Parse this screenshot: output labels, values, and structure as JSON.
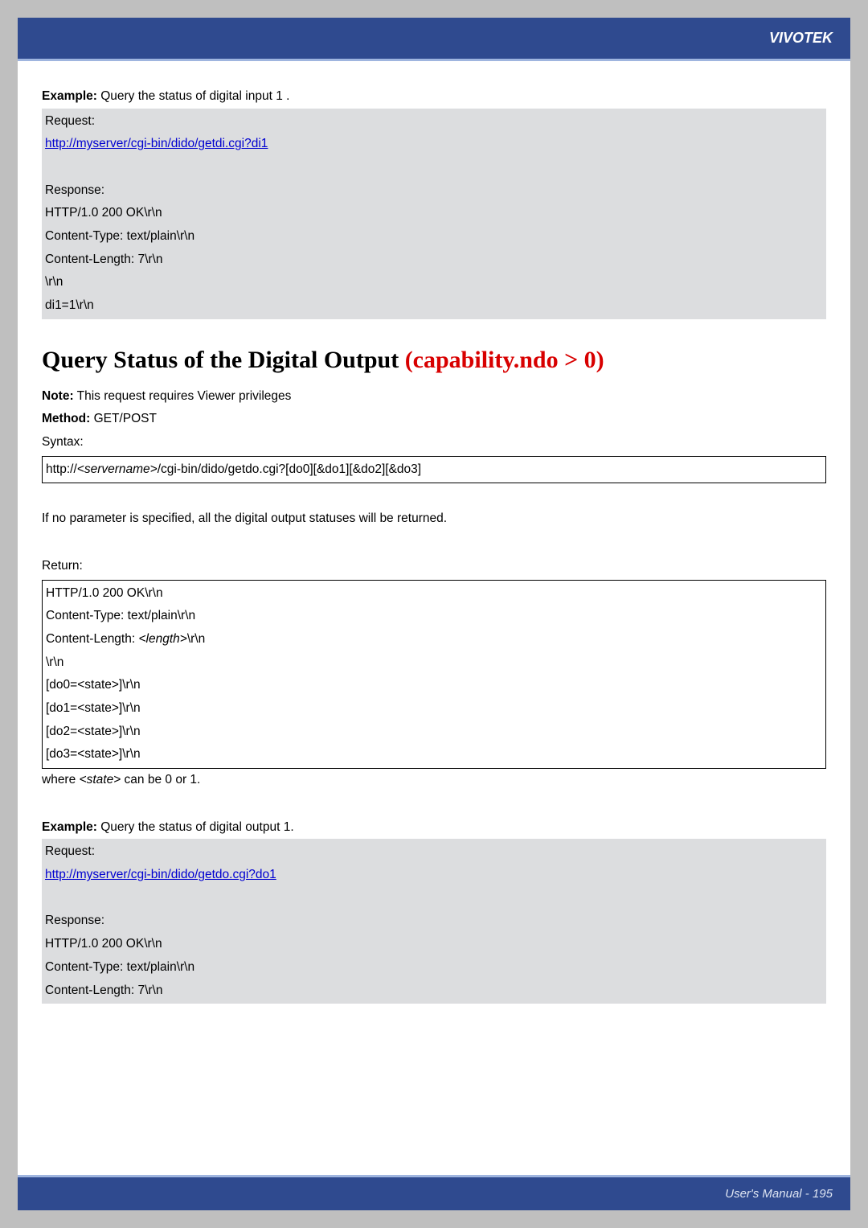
{
  "header": {
    "brand": "VIVOTEK"
  },
  "example1": {
    "label": "Example:",
    "text": " Query the status of digital input 1 .",
    "request_label": "Request:",
    "request_url": "http://myserver/cgi-bin/dido/getdi.cgi?di1",
    "response_label": "Response:",
    "response_lines": [
      "HTTP/1.0 200 OK\\r\\n",
      "Content-Type: text/plain\\r\\n",
      "Content-Length: 7\\r\\n",
      "\\r\\n",
      "di1=1\\r\\n"
    ]
  },
  "section": {
    "title_black": "Query Status of the Digital Output ",
    "title_red": "(capability.ndo > 0)",
    "note_label": "Note:",
    "note_text": " This request requires Viewer privileges",
    "method_label": "Method:",
    "method_text": " GET/POST",
    "syntax_label": "Syntax:",
    "syntax_prefix": "http://",
    "syntax_servername": "<servername>",
    "syntax_suffix": "/cgi-bin/dido/getdo.cgi?[do0][&do1][&do2][&do3]",
    "noparam": "If no parameter is specified, all the digital output statuses will be returned.",
    "return_label": "Return:",
    "return_lines": {
      "l1": "HTTP/1.0 200 OK\\r\\n",
      "l2": "Content-Type: text/plain\\r\\n",
      "l3_a": "Content-Length: ",
      "l3_i": "<length>",
      "l3_b": "\\r\\n",
      "l4": "\\r\\n",
      "l5": "[do0=<state>]\\r\\n",
      "l6": "[do1=<state>]\\r\\n",
      "l7": "[do2=<state>]\\r\\n",
      "l8": "[do3=<state>]\\r\\n"
    },
    "where_a": "where ",
    "where_i": "<state>",
    "where_b": " can be 0 or 1."
  },
  "example2": {
    "label": "Example:",
    "text": " Query the status of digital output 1.",
    "request_label": "Request:",
    "request_url": "http://myserver/cgi-bin/dido/getdo.cgi?do1",
    "response_label": "Response:",
    "response_lines": [
      "HTTP/1.0 200 OK\\r\\n",
      "Content-Type: text/plain\\r\\n",
      "Content-Length: 7\\r\\n"
    ]
  },
  "footer": {
    "text": "User's Manual - 195"
  }
}
